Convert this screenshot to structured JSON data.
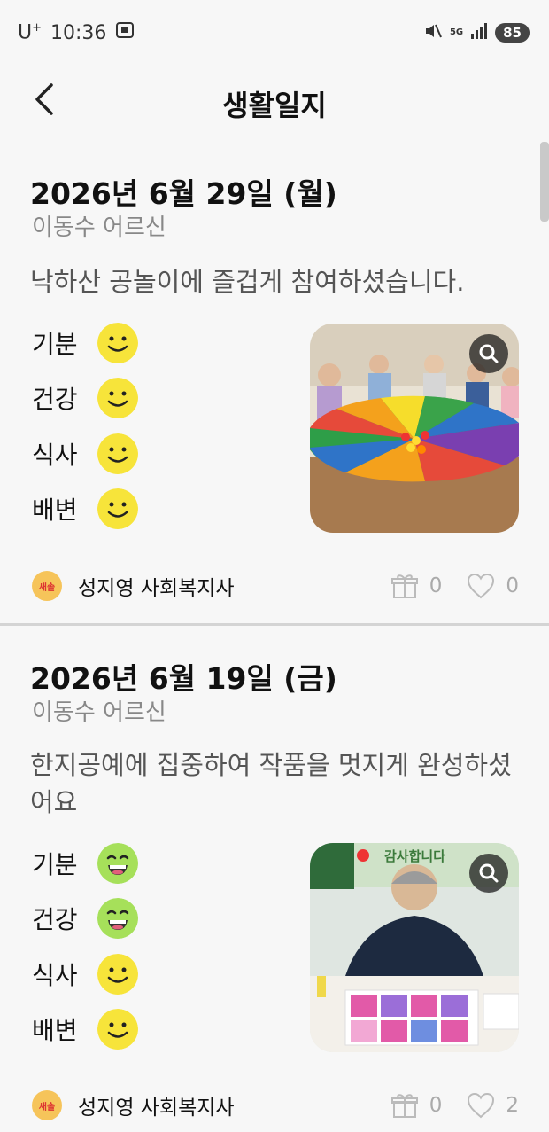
{
  "status_bar": {
    "carrier": "U",
    "carrier_sup": "+",
    "time": "10:36",
    "network": "5G",
    "battery": "85"
  },
  "header": {
    "title": "생활일지"
  },
  "entries": [
    {
      "date": "2026년 6월 29일 (월)",
      "person": "이동수 어르신",
      "text": "낙하산 공놀이에 즐겁게 참여하셨습니다.",
      "conditions": [
        {
          "label": "기분",
          "face": "smile"
        },
        {
          "label": "건강",
          "face": "smile"
        },
        {
          "label": "식사",
          "face": "smile"
        },
        {
          "label": "배변",
          "face": "smile"
        }
      ],
      "photo_icon": "parachute-game-photo",
      "author_badge": "새솔",
      "author": "성지영 사회복지사",
      "gift_count": "0",
      "like_count": "0"
    },
    {
      "date": "2026년 6월 19일 (금)",
      "person": "이동수 어르신",
      "text": "한지공예에 집중하여 작품을 멋지게 완성하셨어요",
      "conditions": [
        {
          "label": "기분",
          "face": "grin"
        },
        {
          "label": "건강",
          "face": "grin"
        },
        {
          "label": "식사",
          "face": "smile"
        },
        {
          "label": "배변",
          "face": "smile"
        }
      ],
      "photo_icon": "hanji-craft-photo",
      "photo_banner": "감사합니다",
      "author_badge": "새솔",
      "author": "성지영 사회복지사",
      "gift_count": "0",
      "like_count": "2"
    }
  ],
  "colors": {
    "smile_face": "#f7e43a",
    "grin_face": "#a6e05a",
    "badge": "#f6c45a"
  }
}
